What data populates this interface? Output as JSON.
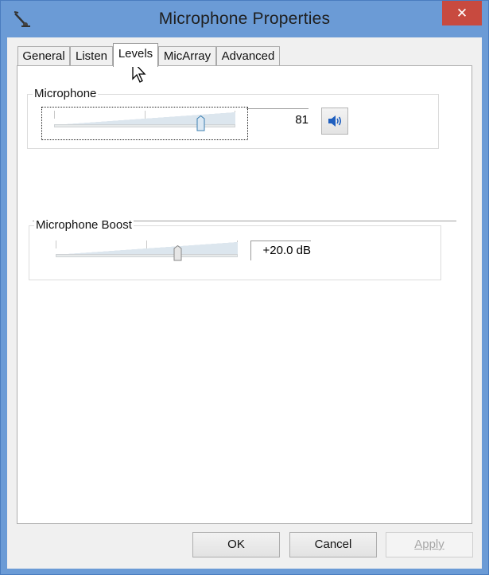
{
  "window": {
    "title": "Microphone Properties",
    "close_glyph": "✕"
  },
  "tabs": [
    {
      "label": "General",
      "active": false
    },
    {
      "label": "Listen",
      "active": false
    },
    {
      "label": "Levels",
      "active": true
    },
    {
      "label": "MicArray",
      "active": false
    },
    {
      "label": "Advanced",
      "active": false
    }
  ],
  "microphone": {
    "group_label": "Microphone",
    "level": 81,
    "level_display": "81",
    "mute_icon": "speaker-icon"
  },
  "boost": {
    "group_label": "Microphone Boost",
    "value_display": "+20.0 dB",
    "level_fraction": 0.67
  },
  "buttons": {
    "ok": "OK",
    "cancel": "Cancel",
    "apply": "Apply"
  },
  "colors": {
    "title_bar": "#6b9bd6",
    "close_button": "#c84a3f",
    "speaker_blue": "#1f5fbf"
  }
}
